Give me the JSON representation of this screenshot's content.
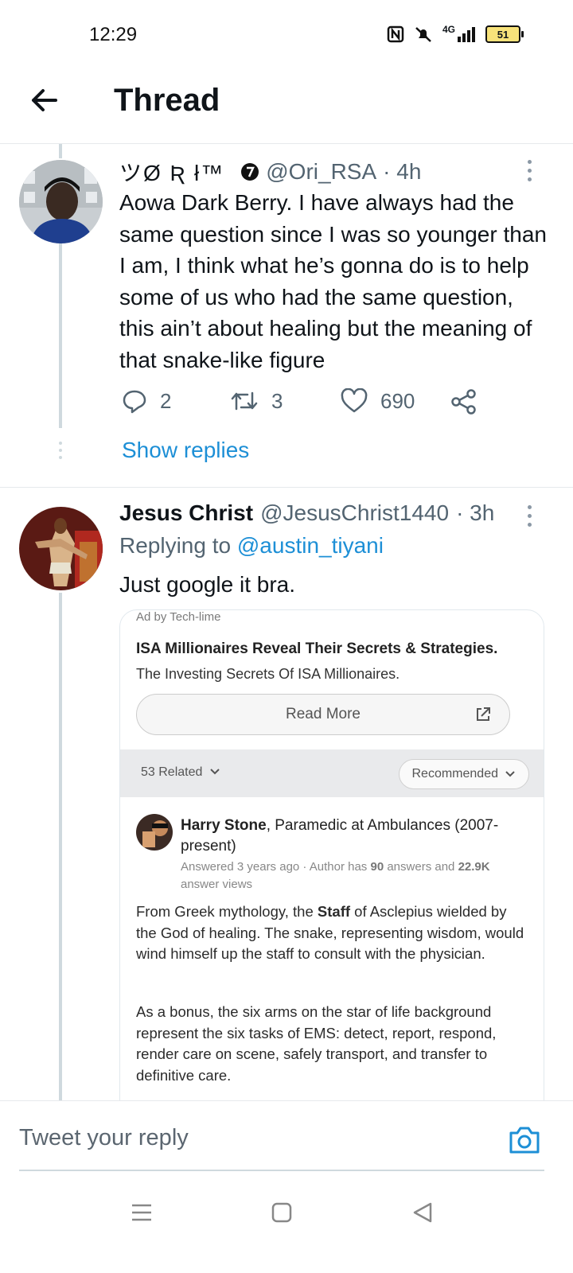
{
  "status_bar": {
    "time": "12:29",
    "network": "4G",
    "battery": "51"
  },
  "header": {
    "title": "Thread"
  },
  "tweet1": {
    "name": "ツØ Ʀ ł™",
    "handle": "@Ori_RSA",
    "time": "· 4h",
    "text": "Aowa Dark Berry. I have always had the same question since I was so younger than I am, I think what he’s gonna do is to help some of us who had the same question, this ain’t about healing but the meaning of that snake-like figure",
    "replies": "2",
    "retweets": "3",
    "likes": "690",
    "show_replies": "Show replies"
  },
  "tweet2": {
    "name": "Jesus Christ",
    "handle": "@JesusChrist1440",
    "time": "· 3h",
    "replying_prefix": "Replying to",
    "replying_to": "@austin_tiyani",
    "text": "Just google it bra."
  },
  "ad_card": {
    "ad_by": "Ad by Tech-lime",
    "title": "ISA Millionaires Reveal Their Secrets & Strategies.",
    "subtitle": "The Investing Secrets Of ISA Millionaires.",
    "read_more": "Read More",
    "related": "53 Related",
    "sort": "Recommended",
    "answer": {
      "author_name": "Harry Stone",
      "author_credential": ", Paramedic at Ambulances (2007-present)",
      "meta_prefix": "Answered 3 years ago · Author has ",
      "answers_count": "90",
      "meta_mid": " answers and ",
      "views": "22.9K",
      "meta_suffix": " answer views",
      "p1_a": "From Greek mythology, the ",
      "p1_bold": "Staff",
      "p1_b": " of Asclepius wielded by the God of healing. The snake, representing wisdom, would wind himself up the staff to consult with the physician.",
      "p2": "As a bonus, the six arms on the star of life background represent the six tasks of EMS: detect, report, respond, render care on scene, safely transport, and transfer to definitive care."
    }
  },
  "reply_bar": {
    "placeholder": "Tweet your reply"
  },
  "colors": {
    "accent": "#1d9bf0",
    "text": "#0f1419",
    "secondary": "#536471",
    "thread_line": "#cfd9de"
  }
}
